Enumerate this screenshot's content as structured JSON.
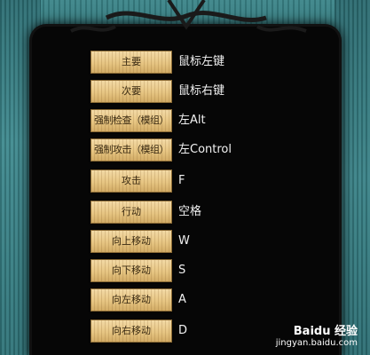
{
  "bindings": [
    {
      "action": "主要",
      "key": "鼠标左键"
    },
    {
      "action": "次要",
      "key": "鼠标右键"
    },
    {
      "action": "强制检查（模组）",
      "key": "左Alt"
    },
    {
      "action": "强制攻击（模组）",
      "key": "左Control"
    },
    {
      "action": "攻击",
      "key": "F"
    },
    {
      "action": "行动",
      "key": "空格"
    },
    {
      "action": "向上移动",
      "key": "W"
    },
    {
      "action": "向下移动",
      "key": "S"
    },
    {
      "action": "向左移动",
      "key": "A"
    },
    {
      "action": "向右移动",
      "key": "D"
    }
  ],
  "watermark": {
    "brand": "Baidu 经验",
    "url": "jingyan.baidu.com"
  },
  "colors": {
    "panel": "#060606",
    "wood": "#e6c582",
    "teal": "#3f8a8f",
    "key_text": "#f2f2f2"
  }
}
